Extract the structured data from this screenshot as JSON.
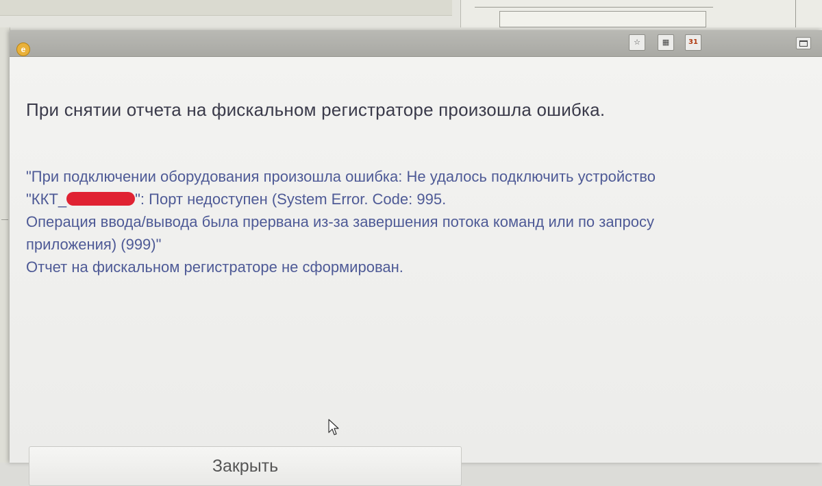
{
  "dialog": {
    "heading": "При снятии отчета на фискальном регистраторе произошла ошибка.",
    "message": {
      "line1": "\"При подключении оборудования произошла ошибка: Не удалось подключить устройство",
      "line2_prefix": "\"ККТ_",
      "line2_suffix": "\": Порт недоступен (System Error.  Code: 995.",
      "line3": "Операция ввода/вывода была прервана из-за завершения потока команд или по запросу",
      "line4": "приложения) (999)\"",
      "line5": "Отчет на фискальном регистраторе не сформирован."
    },
    "close_label": "Закрыть"
  },
  "titlebar": {
    "calendar_day": "31"
  },
  "icons": {
    "app": "app-logo-icon",
    "favorite": "favorite-icon",
    "calculator": "calculator-icon",
    "calendar": "calendar-icon",
    "maximize": "maximize-icon",
    "cursor": "mouse-cursor-icon"
  },
  "colors": {
    "heading": "#3a3a4a",
    "message": "#4e5a96",
    "redaction": "#e02232"
  }
}
